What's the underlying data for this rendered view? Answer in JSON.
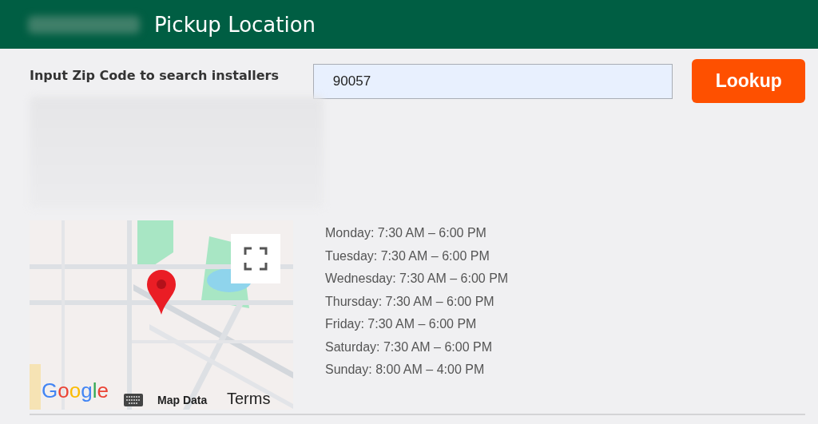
{
  "header": {
    "title": "Pickup Location"
  },
  "search": {
    "label": "Input Zip Code to search installers",
    "value": "90057",
    "button": "Lookup"
  },
  "map": {
    "attribution": "Google",
    "map_data": "Map Data",
    "terms": "Terms"
  },
  "hours": [
    "Monday: 7:30 AM – 6:00 PM",
    "Tuesday: 7:30 AM – 6:00 PM",
    "Wednesday: 7:30 AM – 6:00 PM",
    "Thursday: 7:30 AM – 6:00 PM",
    "Friday: 7:30 AM – 6:00 PM",
    "Saturday: 7:30 AM – 6:00 PM",
    "Sunday: 8:00 AM – 4:00 PM"
  ]
}
